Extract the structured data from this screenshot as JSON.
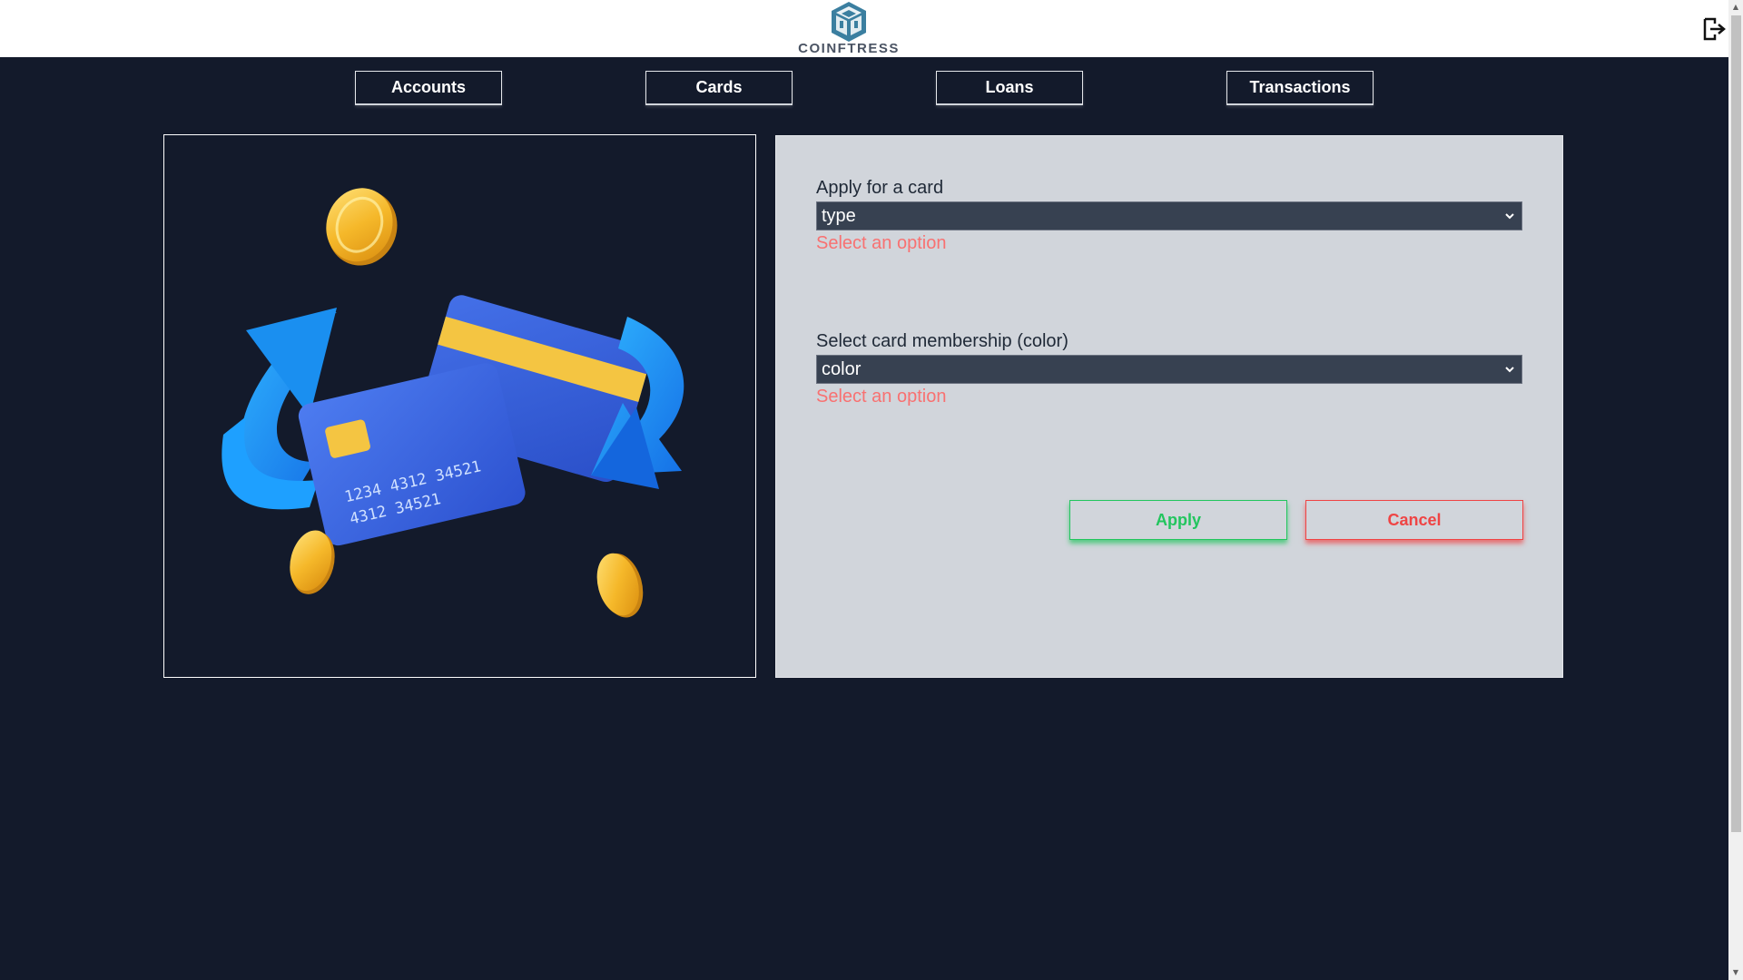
{
  "header": {
    "logo_text": "COINFTRESS",
    "logo_icon": "fortress-logo-icon",
    "logout_icon": "logout-icon"
  },
  "nav": {
    "items": [
      {
        "label": "Accounts"
      },
      {
        "label": "Cards"
      },
      {
        "label": "Loans"
      },
      {
        "label": "Transactions"
      }
    ]
  },
  "illustration": {
    "card_number_line1": "1234 4312 34521",
    "card_number_line2": "4312 34521"
  },
  "form": {
    "card_type": {
      "label": "Apply for a card",
      "selected": "type",
      "error": "Select an option"
    },
    "card_color": {
      "label": "Select card membership (color)",
      "selected": "color",
      "error": "Select an option"
    },
    "apply_label": "Apply",
    "cancel_label": "Cancel"
  },
  "colors": {
    "background": "#131a2b",
    "panel": "#d1d5db",
    "apply": "#22c55e",
    "cancel": "#ef4444",
    "error": "#f87171",
    "logo": "#3b82a0"
  }
}
